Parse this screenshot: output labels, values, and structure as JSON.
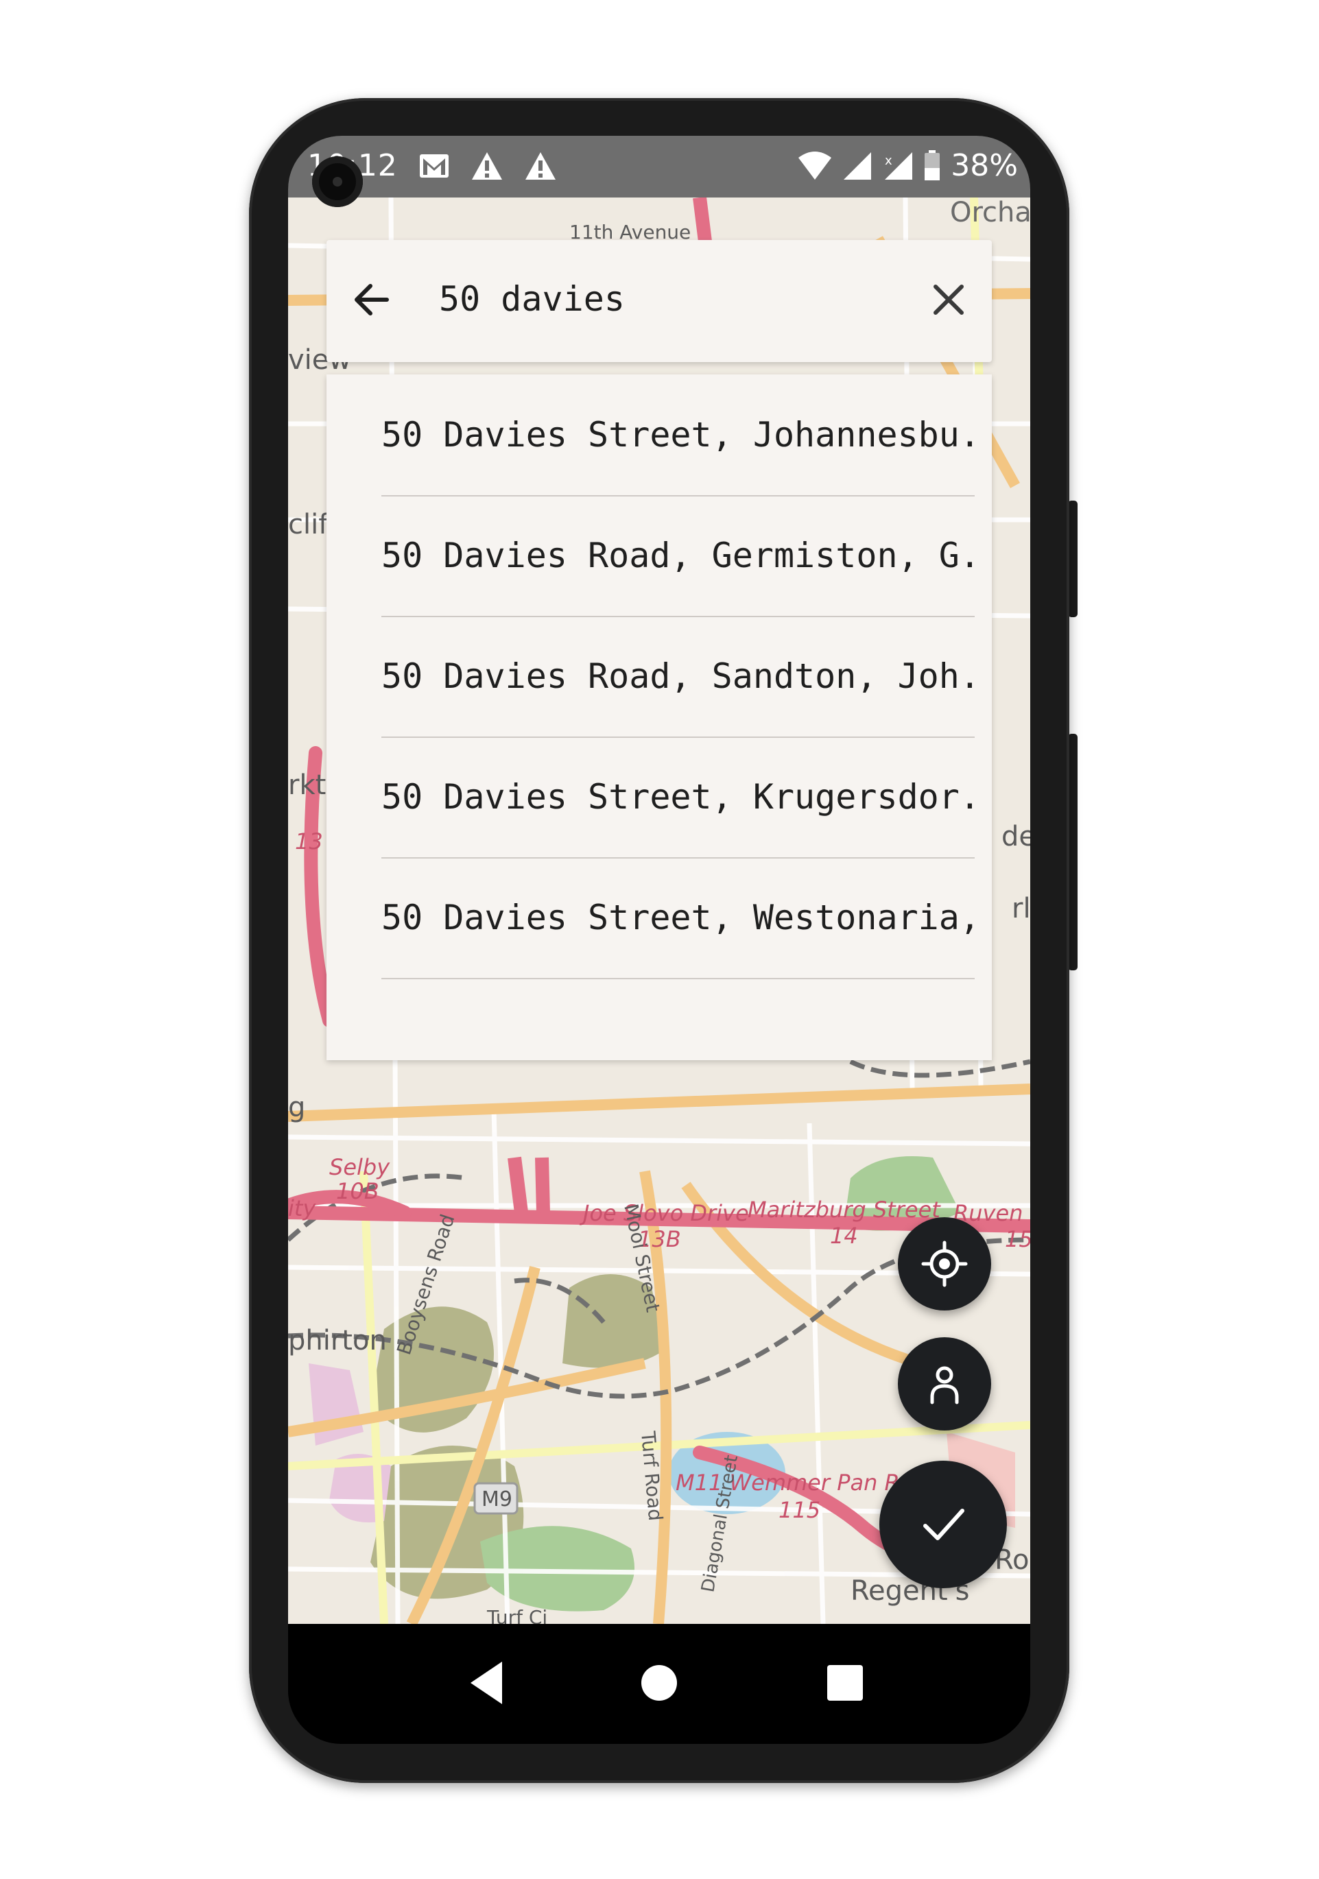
{
  "status_bar": {
    "time": "10:12",
    "battery_percent": "38%",
    "icons": [
      "gmail-icon",
      "alert-icon",
      "alert-icon",
      "wifi-icon",
      "cell-signal-icon",
      "cell-signal-icon",
      "battery-icon"
    ]
  },
  "search": {
    "query": "50 davies",
    "back_icon": "arrow-back-icon",
    "clear_icon": "close-icon"
  },
  "suggestions": [
    "50 Davies Street, Johannesbu...",
    "50 Davies Road, Germiston, G...",
    "50 Davies Road, Sandton, Joh...",
    "50 Davies Street, Krugersdor...",
    "50 Davies Street, Westonaria,..."
  ],
  "map": {
    "labels": {
      "orchards": "Orcha",
      "eleventh_avenue": "11th Avenue",
      "view": "view",
      "clif": "clif",
      "rkt": "rkt",
      "num_13": "13",
      "der": "der",
      "rl": "rl",
      "g": "g",
      "selby": "Selby",
      "exit_10b": "10B",
      "ity": "ity",
      "joe_slovo": "Joe Slovo Drive",
      "exit_13b": "13B",
      "maritzburg": "Maritzburg Street",
      "exit_14": "14",
      "ruven": "Ruven",
      "exit_15": "15",
      "booysens": "Booysens Road",
      "mooi": "Mooi Street",
      "phirton": "phirton",
      "m11": "M11 Wemmer Pan Roa",
      "exit_115": "115",
      "turf_road": "Turf Road",
      "m9": "M9",
      "diagonal": "Diagonal Street",
      "regents": "Regent's",
      "ro": "Ro",
      "turf_ci": "Turf Ci"
    },
    "colors": {
      "background": "#efeae1",
      "highway": "#e26f86",
      "primary": "#f3c683",
      "secondary": "#f7f6b4",
      "park": "#a9cd98",
      "wood": "#b4b58a",
      "water": "#a8d2e6",
      "rail": "#707070"
    }
  },
  "fabs": {
    "locate_icon": "my-location-icon",
    "person_icon": "person-icon",
    "confirm_icon": "check-icon"
  },
  "nav": {
    "back_icon": "nav-back-icon",
    "home_icon": "nav-home-icon",
    "recents_icon": "nav-recents-icon"
  },
  "accent_color": "#1d1f22"
}
